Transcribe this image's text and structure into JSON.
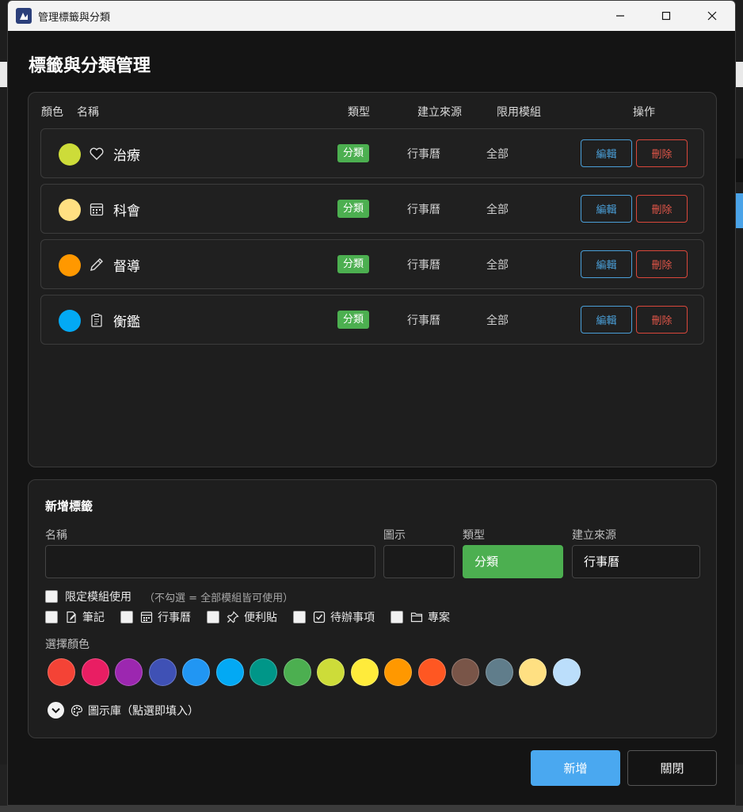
{
  "window": {
    "title": "管理標籤與分類"
  },
  "dialog": {
    "title": "標籤與分類管理"
  },
  "list": {
    "headers": {
      "color": "顏色",
      "name": "名稱",
      "type": "類型",
      "source": "建立來源",
      "module": "限用模組",
      "actions": "操作"
    },
    "rows": [
      {
        "color": "#cddc39",
        "icon": "heart-icon",
        "name": "治療",
        "type": "分類",
        "source": "行事曆",
        "module": "全部",
        "edit": "編輯",
        "delete": "刪除"
      },
      {
        "color": "#ffe082",
        "icon": "calendar-icon",
        "name": "科會",
        "type": "分類",
        "source": "行事曆",
        "module": "全部",
        "edit": "編輯",
        "delete": "刪除"
      },
      {
        "color": "#ff9800",
        "icon": "pencil-icon",
        "name": "督導",
        "type": "分類",
        "source": "行事曆",
        "module": "全部",
        "edit": "編輯",
        "delete": "刪除"
      },
      {
        "color": "#03a9f4",
        "icon": "clipboard-icon",
        "name": "衡鑑",
        "type": "分類",
        "source": "行事曆",
        "module": "全部",
        "edit": "編輯",
        "delete": "刪除"
      }
    ]
  },
  "add": {
    "title": "新增標籤",
    "name_label": "名稱",
    "name_value": "",
    "icon_label": "圖示",
    "icon_value": "",
    "type_label": "類型",
    "type_value": "分類",
    "source_label": "建立來源",
    "source_value": "行事曆",
    "limit_label": "限定模組使用",
    "limit_hint": "（不勾選 = 全部模組皆可使用）",
    "modules": [
      {
        "label": "筆記",
        "icon": "note-edit-icon"
      },
      {
        "label": "行事曆",
        "icon": "calendar-icon"
      },
      {
        "label": "便利貼",
        "icon": "pin-icon"
      },
      {
        "label": "待辦事項",
        "icon": "checkbox-icon"
      },
      {
        "label": "專案",
        "icon": "folder-icon"
      }
    ],
    "color_label": "選擇顏色",
    "colors": [
      "#f44336",
      "#e91e63",
      "#9c27b0",
      "#3f51b5",
      "#2196f3",
      "#03a9f4",
      "#009688",
      "#4caf50",
      "#cddc39",
      "#ffeb3b",
      "#ff9800",
      "#ff5722",
      "#795548",
      "#607d8b",
      "#ffe082",
      "#bbdefb"
    ],
    "library_label": "圖示庫（點選即填入）"
  },
  "buttons": {
    "add": "新增",
    "close": "關閉"
  }
}
